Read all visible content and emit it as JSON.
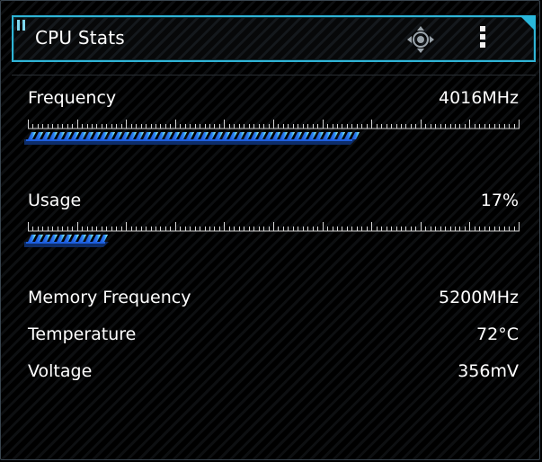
{
  "widget": {
    "title": "CPU Stats",
    "move_icon": "move-crosshair-icon",
    "menu_icon": "kebab-menu-icon",
    "accent_color": "#2fb4d6"
  },
  "stats": {
    "frequency": {
      "label": "Frequency",
      "value": "4016MHz",
      "bar_fraction": 0.67
    },
    "usage": {
      "label": "Usage",
      "value": "17%",
      "bar_fraction": 0.17
    },
    "memory_frequency": {
      "label": "Memory Frequency",
      "value": "5200MHz"
    },
    "temperature": {
      "label": "Temperature",
      "value": "72°C"
    },
    "voltage": {
      "label": "Voltage",
      "value": "356mV"
    }
  }
}
